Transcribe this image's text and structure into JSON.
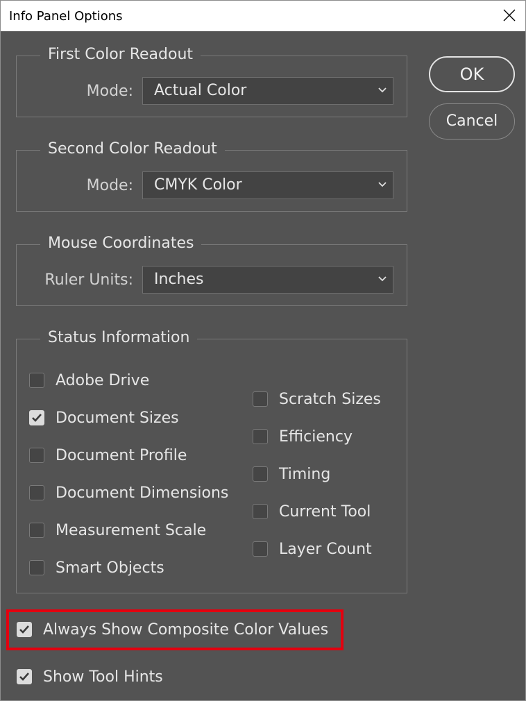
{
  "window": {
    "title": "Info Panel Options"
  },
  "buttons": {
    "ok": "OK",
    "cancel": "Cancel"
  },
  "first_color": {
    "legend": "First Color Readout",
    "label": "Mode:",
    "value": "Actual Color"
  },
  "second_color": {
    "legend": "Second Color Readout",
    "label": "Mode:",
    "value": "CMYK Color"
  },
  "mouse": {
    "legend": "Mouse Coordinates",
    "label": "Ruler Units:",
    "value": "Inches"
  },
  "status": {
    "legend": "Status Information",
    "left": [
      {
        "label": "Adobe Drive",
        "checked": false
      },
      {
        "label": "Document Sizes",
        "checked": true
      },
      {
        "label": "Document Profile",
        "checked": false
      },
      {
        "label": "Document Dimensions",
        "checked": false
      },
      {
        "label": "Measurement Scale",
        "checked": false
      },
      {
        "label": "Smart Objects",
        "checked": false
      }
    ],
    "right": [
      {
        "label": "Scratch Sizes",
        "checked": false
      },
      {
        "label": "Efficiency",
        "checked": false
      },
      {
        "label": "Timing",
        "checked": false
      },
      {
        "label": "Current Tool",
        "checked": false
      },
      {
        "label": "Layer Count",
        "checked": false
      }
    ]
  },
  "options": [
    {
      "label": "Always Show Composite Color Values",
      "checked": true
    },
    {
      "label": "Show Tool Hints",
      "checked": true
    }
  ]
}
